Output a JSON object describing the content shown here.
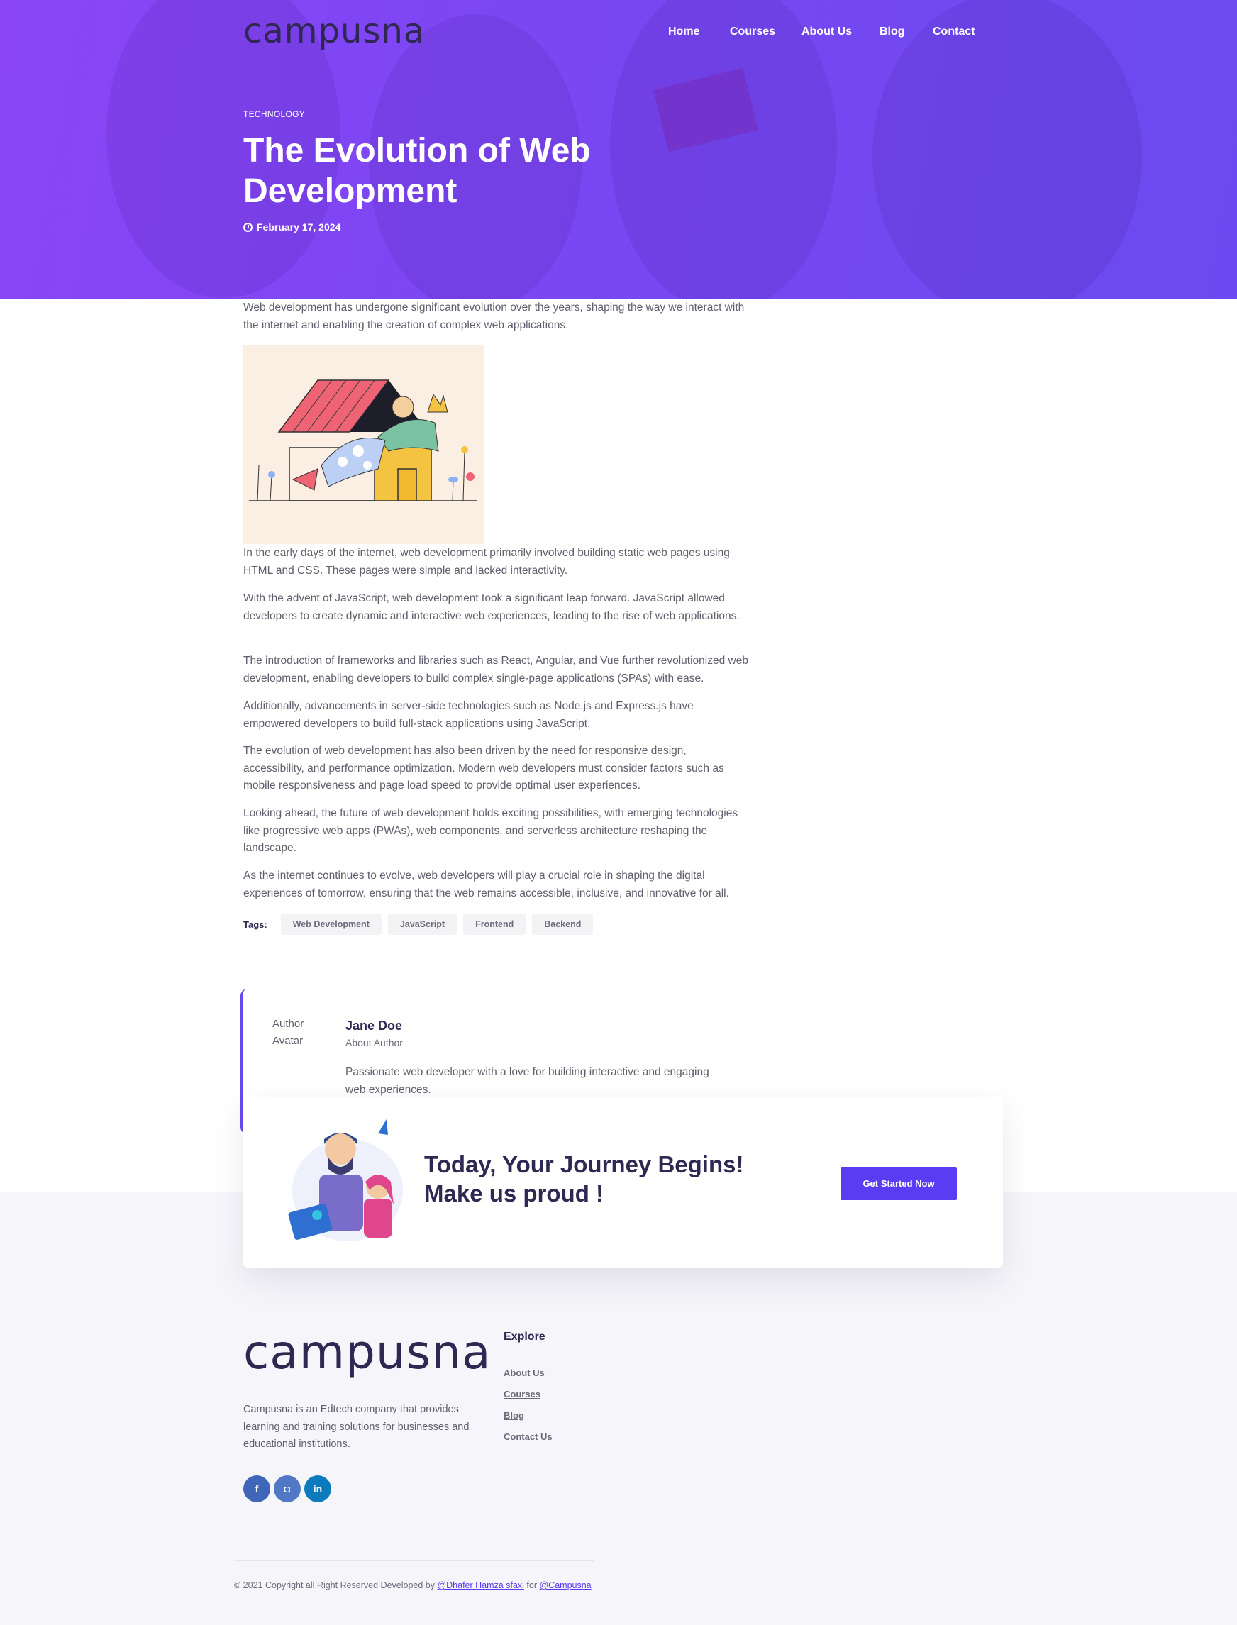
{
  "brand": {
    "name": "campusna"
  },
  "nav": {
    "items": [
      "Home",
      "Courses",
      "About Us",
      "Blog",
      "Contact"
    ]
  },
  "article": {
    "category": "TECHNOLOGY",
    "title": "The Evolution of Web Development",
    "date": "February 17, 2024",
    "intro": "Web development has undergone significant evolution over the years, shaping the way we interact with the internet and enabling the creation of complex web applications.",
    "paragraphs": [
      "In the early days of the internet, web development primarily involved building static web pages using HTML and CSS. These pages were simple and lacked interactivity.",
      "With the advent of JavaScript, web development took a significant leap forward. JavaScript allowed developers to create dynamic and interactive web experiences, leading to the rise of web applications.",
      "The introduction of frameworks and libraries such as React, Angular, and Vue further revolutionized web development, enabling developers to build complex single-page applications (SPAs) with ease.",
      "Additionally, advancements in server-side technologies such as Node.js and Express.js have empowered developers to build full-stack applications using JavaScript.",
      "The evolution of web development has also been driven by the need for responsive design, accessibility, and performance optimization. Modern web developers must consider factors such as mobile responsiveness and page load speed to provide optimal user experiences.",
      "Looking ahead, the future of web development holds exciting possibilities, with emerging technologies like progressive web apps (PWAs), web components, and serverless architecture reshaping the landscape.",
      "As the internet continues to evolve, web developers will play a crucial role in shaping the digital experiences of tomorrow, ensuring that the web remains accessible, inclusive, and innovative for all."
    ],
    "tags_label": "Tags:",
    "tags": [
      "Web Development",
      "JavaScript",
      "Frontend",
      "Backend"
    ]
  },
  "author": {
    "avatar_alt": "Author Avatar",
    "name": "Jane Doe",
    "role": "About Author",
    "bio": "Passionate web developer with a love for building interactive and engaging web experiences."
  },
  "cta": {
    "title_line1": "Today, Your Journey Begins!",
    "title_line2": "Make us proud !",
    "button": "Get Started Now"
  },
  "footer": {
    "description": "Campusna is an Edtech company that provides learning and training solutions for businesses and educational institutions.",
    "social": [
      {
        "name": "facebook-icon",
        "glyph": "f",
        "color": "#3f66b8"
      },
      {
        "name": "instagram-icon",
        "glyph": "◘",
        "color": "#5178c4"
      },
      {
        "name": "linkedin-icon",
        "glyph": "in",
        "color": "#0b7bbd"
      }
    ],
    "explore_heading": "Explore",
    "explore_links": [
      "About Us",
      "Courses",
      "Blog",
      "Contact Us"
    ],
    "copyright_prefix": "© 2021 Copyright all Right Reserved Developed by",
    "copyright_author": "@Dhafer Hamza sfaxi",
    "copyright_for": "for",
    "copyright_brand": "@Campusna"
  },
  "colors": {
    "accent": "#5a3df2",
    "hero_start": "#8b45f6",
    "hero_end": "#6a4af0",
    "heading": "#2e2852"
  }
}
